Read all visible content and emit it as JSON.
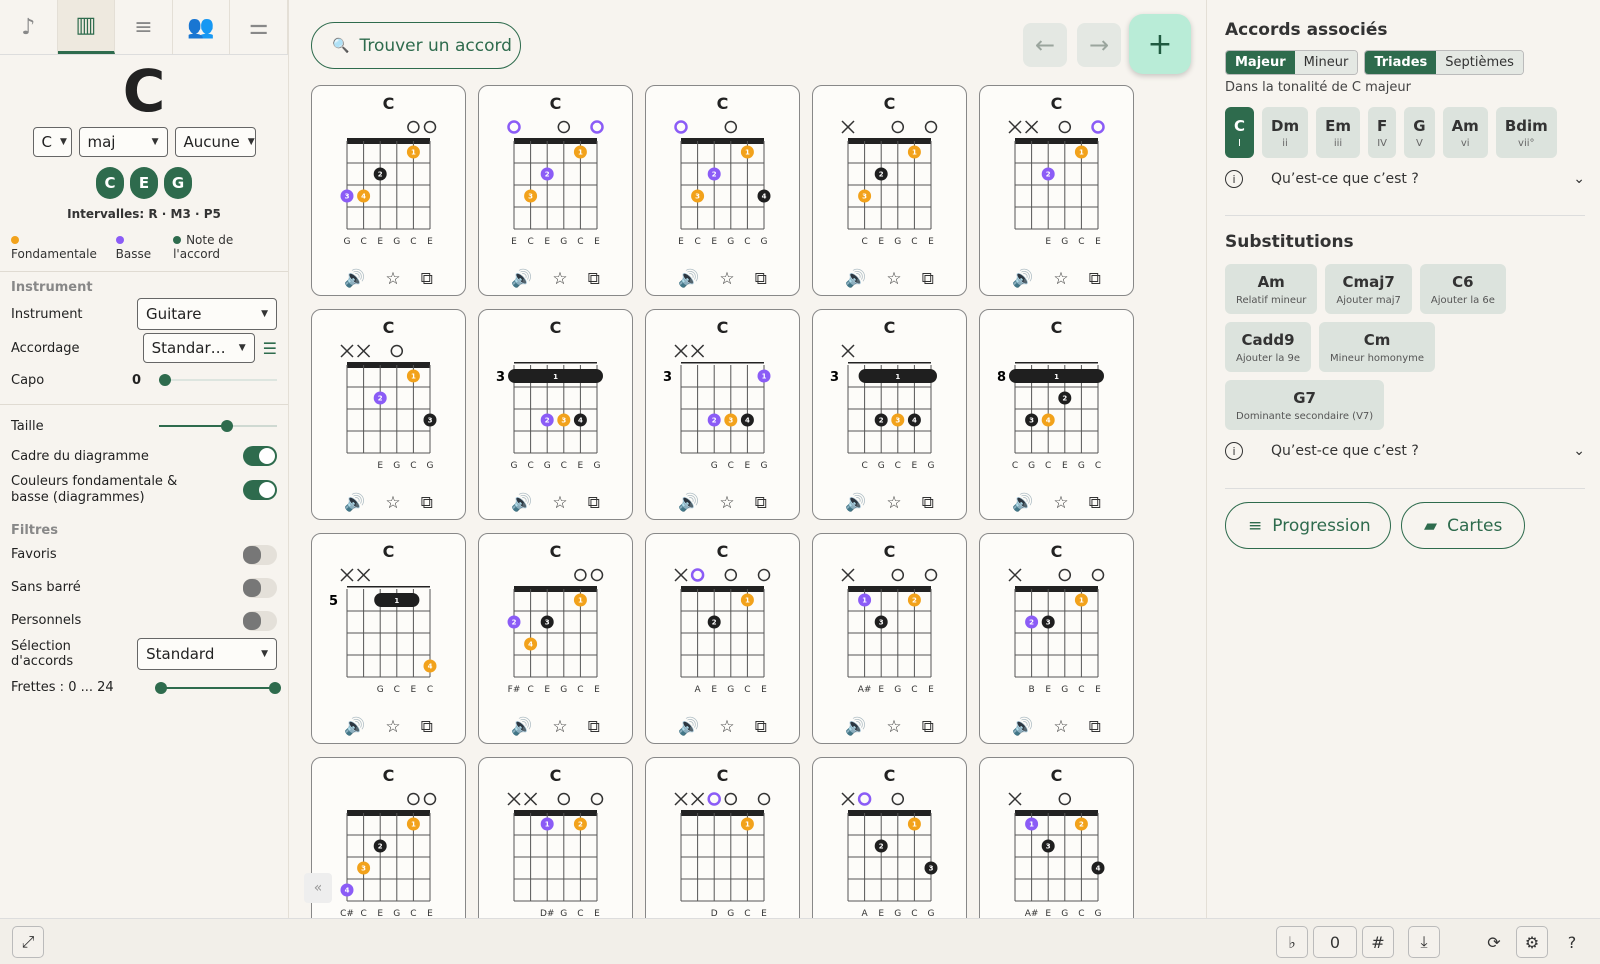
{
  "tabs": [
    {
      "icon": "♪",
      "name": "music-note-icon"
    },
    {
      "icon": "▥",
      "name": "piano-icon"
    },
    {
      "icon": "≡",
      "name": "playlist-icon"
    },
    {
      "icon": "👥",
      "name": "people-icon"
    },
    {
      "icon": "⚌",
      "name": "sliders-icon"
    }
  ],
  "chord": {
    "root": "C",
    "quality": "maj",
    "bass": "Aucune",
    "notes": [
      "C",
      "E",
      "G"
    ],
    "intervals": "Intervalles: R · M3 · P5"
  },
  "legend": {
    "root": "Fondamentale",
    "bass": "Basse",
    "note": "Note de l'accord"
  },
  "instrument_section": "Instrument",
  "instrument_label": "Instrument",
  "instrument_value": "Guitare",
  "tuning_label": "Accordage",
  "tuning_value": "Standar…",
  "capo_label": "Capo",
  "capo_value": "0",
  "size_label": "Taille",
  "frame_label": "Cadre du diagramme",
  "colors_label": "Couleurs fondamentale & basse (diagrammes)",
  "filters_section": "Filtres",
  "fav_label": "Favoris",
  "nobarre_label": "Sans barré",
  "personal_label": "Personnels",
  "selection_label": "Sélection d'accords",
  "selection_value": "Standard",
  "frets_label": "Frettes : 0 ... 24",
  "search_label": "Trouver un accord",
  "fab_label": "+",
  "card_name": "C",
  "colors": {
    "root": "#f2a21b",
    "bass": "#8b5cf6",
    "note": "#1f1f1f",
    "accent": "#2e6b4d"
  },
  "cards": [
    {
      "s": [
        "",
        "",
        "",
        "",
        "o",
        "o"
      ],
      "start": 1,
      "d": [
        {
          "st": 4,
          "f": 1,
          "n": "1",
          "r": true
        },
        {
          "st": 2,
          "f": 2,
          "n": "2"
        },
        {
          "st": 0,
          "f": 3,
          "n": "3",
          "b": true
        },
        {
          "st": 1,
          "f": 3,
          "n": "4",
          "r": true
        }
      ],
      "l": [
        "G",
        "C",
        "E",
        "G",
        "C",
        "E"
      ],
      "bs": 0,
      "rs": []
    },
    {
      "s": [
        "o",
        "",
        "",
        "o",
        "",
        "o"
      ],
      "start": 1,
      "d": [
        {
          "st": 4,
          "f": 1,
          "n": "1",
          "r": true
        },
        {
          "st": 2,
          "f": 2,
          "n": "2",
          "b": true
        },
        {
          "st": 1,
          "f": 3,
          "n": "3",
          "r": true
        }
      ],
      "l": [
        "E",
        "C",
        "E",
        "G",
        "C",
        "E"
      ],
      "bs": 0,
      "rs": [
        0,
        5
      ]
    },
    {
      "s": [
        "o",
        "",
        "",
        "o",
        "",
        ""
      ],
      "start": 1,
      "d": [
        {
          "st": 4,
          "f": 1,
          "n": "1",
          "r": true
        },
        {
          "st": 2,
          "f": 2,
          "n": "2",
          "b": true
        },
        {
          "st": 1,
          "f": 3,
          "n": "3",
          "r": true
        },
        {
          "st": 5,
          "f": 3,
          "n": "4"
        }
      ],
      "l": [
        "E",
        "C",
        "E",
        "G",
        "C",
        "G"
      ],
      "bs": 0,
      "rs": [
        0
      ]
    },
    {
      "s": [
        "x",
        "",
        "",
        "o",
        "",
        "o"
      ],
      "start": 1,
      "d": [
        {
          "st": 4,
          "f": 1,
          "n": "1",
          "r": true
        },
        {
          "st": 2,
          "f": 2,
          "n": "2"
        },
        {
          "st": 1,
          "f": 3,
          "n": "3",
          "r": true
        }
      ],
      "l": [
        "",
        "C",
        "E",
        "G",
        "C",
        "E"
      ],
      "bs": -1,
      "rs": []
    },
    {
      "s": [
        "x",
        "x",
        "",
        "o",
        "",
        "o"
      ],
      "start": 1,
      "d": [
        {
          "st": 4,
          "f": 1,
          "n": "1",
          "r": true
        },
        {
          "st": 2,
          "f": 2,
          "n": "2",
          "b": true
        }
      ],
      "l": [
        "",
        "",
        "E",
        "G",
        "C",
        "E"
      ],
      "bs": -1,
      "rs": [
        5
      ]
    },
    {
      "s": [
        "x",
        "x",
        "",
        "o",
        "",
        ""
      ],
      "start": 1,
      "d": [
        {
          "st": 4,
          "f": 1,
          "n": "1",
          "r": true
        },
        {
          "st": 2,
          "f": 2,
          "n": "2",
          "b": true
        },
        {
          "st": 5,
          "f": 3,
          "n": "3"
        }
      ],
      "l": [
        "",
        "",
        "E",
        "G",
        "C",
        "G"
      ],
      "bs": -1,
      "rs": []
    },
    {
      "s": [
        "",
        "",
        "",
        "",
        "",
        ""
      ],
      "start": 3,
      "barre": [
        0,
        5
      ],
      "d": [
        {
          "st": 2,
          "f": 3,
          "n": "2",
          "b": true
        },
        {
          "st": 3,
          "f": 3,
          "n": "3",
          "r": true
        },
        {
          "st": 4,
          "f": 3,
          "n": "4"
        }
      ],
      "l": [
        "G",
        "C",
        "G",
        "C",
        "E",
        "G"
      ],
      "bs": -1,
      "rs": []
    },
    {
      "s": [
        "x",
        "x",
        "",
        "",
        "",
        ""
      ],
      "start": 3,
      "d": [
        {
          "st": 5,
          "f": 1,
          "n": "1",
          "b": true
        },
        {
          "st": 2,
          "f": 3,
          "n": "2",
          "b": true
        },
        {
          "st": 3,
          "f": 3,
          "n": "3",
          "r": true
        },
        {
          "st": 4,
          "f": 3,
          "n": "4"
        }
      ],
      "l": [
        "",
        "",
        "G",
        "C",
        "E",
        "G"
      ],
      "bs": -1,
      "rs": []
    },
    {
      "s": [
        "x",
        "",
        "",
        "",
        "",
        ""
      ],
      "start": 3,
      "barre": [
        1,
        5
      ],
      "d": [
        {
          "st": 2,
          "f": 3,
          "n": "2"
        },
        {
          "st": 3,
          "f": 3,
          "n": "3",
          "r": true
        },
        {
          "st": 4,
          "f": 3,
          "n": "4"
        }
      ],
      "l": [
        "",
        "C",
        "G",
        "C",
        "E",
        "G"
      ],
      "bs": -1,
      "rs": []
    },
    {
      "s": [
        "",
        "",
        "",
        "",
        "",
        ""
      ],
      "start": 8,
      "barre": [
        0,
        5
      ],
      "d": [
        {
          "st": 3,
          "f": 2,
          "n": "2"
        },
        {
          "st": 1,
          "f": 3,
          "n": "3"
        },
        {
          "st": 2,
          "f": 3,
          "n": "4",
          "r": true
        }
      ],
      "l": [
        "C",
        "G",
        "C",
        "E",
        "G",
        "C"
      ],
      "bs": -1,
      "rs": []
    },
    {
      "s": [
        "x",
        "x",
        "",
        "",
        "",
        ""
      ],
      "start": 5,
      "barre": [
        2,
        4
      ],
      "d": [
        {
          "st": 5,
          "f": 4,
          "n": "4",
          "r": true
        }
      ],
      "l": [
        "",
        "",
        "G",
        "C",
        "E",
        "C"
      ],
      "bs": -1,
      "rs": []
    },
    {
      "s": [
        "",
        "",
        "",
        "",
        "o",
        "o"
      ],
      "start": 1,
      "d": [
        {
          "st": 4,
          "f": 1,
          "n": "1",
          "r": true
        },
        {
          "st": 0,
          "f": 2,
          "n": "2",
          "b": true
        },
        {
          "st": 2,
          "f": 2,
          "n": "3"
        },
        {
          "st": 1,
          "f": 3,
          "n": "4",
          "r": true
        }
      ],
      "l": [
        "F#",
        "C",
        "E",
        "G",
        "C",
        "E"
      ],
      "bs": -1,
      "rs": []
    },
    {
      "s": [
        "x",
        "o",
        "",
        "o",
        "",
        "o"
      ],
      "start": 1,
      "d": [
        {
          "st": 4,
          "f": 1,
          "n": "1",
          "r": true
        },
        {
          "st": 2,
          "f": 2,
          "n": "2"
        }
      ],
      "l": [
        "",
        "A",
        "E",
        "G",
        "C",
        "E"
      ],
      "bs": -1,
      "rs": [
        1
      ]
    },
    {
      "s": [
        "x",
        "",
        "",
        "o",
        "",
        "o"
      ],
      "start": 1,
      "d": [
        {
          "st": 1,
          "f": 1,
          "n": "1",
          "b": true
        },
        {
          "st": 4,
          "f": 1,
          "n": "2",
          "r": true
        },
        {
          "st": 2,
          "f": 2,
          "n": "3"
        }
      ],
      "l": [
        "",
        "A#",
        "E",
        "G",
        "C",
        "E"
      ],
      "bs": -1,
      "rs": []
    },
    {
      "s": [
        "x",
        "",
        "",
        "o",
        "",
        "o"
      ],
      "start": 1,
      "d": [
        {
          "st": 4,
          "f": 1,
          "n": "1",
          "r": true
        },
        {
          "st": 1,
          "f": 2,
          "n": "2",
          "b": true
        },
        {
          "st": 2,
          "f": 2,
          "n": "3"
        }
      ],
      "l": [
        "",
        "B",
        "E",
        "G",
        "C",
        "E"
      ],
      "bs": -1,
      "rs": []
    },
    {
      "s": [
        "",
        "",
        "",
        "",
        "o",
        "o"
      ],
      "start": 1,
      "d": [
        {
          "st": 4,
          "f": 1,
          "n": "1",
          "r": true
        },
        {
          "st": 2,
          "f": 2,
          "n": "2"
        },
        {
          "st": 1,
          "f": 3,
          "n": "3",
          "r": true
        },
        {
          "st": 0,
          "f": 4,
          "n": "4",
          "b": true
        }
      ],
      "l": [
        "C#",
        "C",
        "E",
        "G",
        "C",
        "E"
      ],
      "bs": -1,
      "rs": []
    },
    {
      "s": [
        "x",
        "x",
        "",
        "o",
        "",
        "o"
      ],
      "start": 1,
      "d": [
        {
          "st": 2,
          "f": 1,
          "n": "1",
          "b": true
        },
        {
          "st": 4,
          "f": 1,
          "n": "2",
          "r": true
        }
      ],
      "l": [
        "",
        "",
        "D#",
        "G",
        "C",
        "E"
      ],
      "bs": -1,
      "rs": []
    },
    {
      "s": [
        "x",
        "x",
        "o",
        "o",
        "",
        "o"
      ],
      "start": 1,
      "d": [
        {
          "st": 4,
          "f": 1,
          "n": "1",
          "r": true
        }
      ],
      "l": [
        "",
        "",
        "D",
        "G",
        "C",
        "E"
      ],
      "bs": -1,
      "rs": [
        2
      ]
    },
    {
      "s": [
        "x",
        "o",
        "",
        "o",
        "",
        ""
      ],
      "start": 1,
      "d": [
        {
          "st": 4,
          "f": 1,
          "n": "1",
          "r": true
        },
        {
          "st": 2,
          "f": 2,
          "n": "2"
        },
        {
          "st": 5,
          "f": 3,
          "n": "3"
        }
      ],
      "l": [
        "",
        "A",
        "E",
        "G",
        "C",
        "G"
      ],
      "bs": -1,
      "rs": [
        1
      ]
    },
    {
      "s": [
        "x",
        "",
        "",
        "o",
        "",
        ""
      ],
      "start": 1,
      "d": [
        {
          "st": 1,
          "f": 1,
          "n": "1",
          "b": true
        },
        {
          "st": 4,
          "f": 1,
          "n": "2",
          "r": true
        },
        {
          "st": 2,
          "f": 2,
          "n": "3"
        },
        {
          "st": 5,
          "f": 3,
          "n": "4"
        }
      ],
      "l": [
        "",
        "A#",
        "E",
        "G",
        "C",
        "G"
      ],
      "bs": -1,
      "rs": []
    }
  ],
  "right": {
    "related_title": "Accords associés",
    "mode_major": "Majeur",
    "mode_minor": "Mineur",
    "type_triads": "Triades",
    "type_sevenths": "Septièmes",
    "key_text": "Dans la tonalité de C majeur",
    "degrees": [
      {
        "c": "C",
        "r": "I"
      },
      {
        "c": "Dm",
        "r": "ii"
      },
      {
        "c": "Em",
        "r": "iii"
      },
      {
        "c": "F",
        "r": "IV"
      },
      {
        "c": "G",
        "r": "V"
      },
      {
        "c": "Am",
        "r": "vi"
      },
      {
        "c": "Bdim",
        "r": "vii°"
      }
    ],
    "what": "Qu’est-ce que c’est ?",
    "subs_title": "Substitutions",
    "subs": [
      {
        "c": "Am",
        "d": "Relatif mineur"
      },
      {
        "c": "Cmaj7",
        "d": "Ajouter maj7"
      },
      {
        "c": "C6",
        "d": "Ajouter la 6e"
      },
      {
        "c": "Cadd9",
        "d": "Ajouter la 9e"
      },
      {
        "c": "Cm",
        "d": "Mineur homonyme"
      },
      {
        "c": "G7",
        "d": "Dominante secondaire (V7)"
      }
    ],
    "what2": "Qu’est-ce que c’est ?",
    "progression": "Progression",
    "cards_btn": "Cartes"
  },
  "bottom": {
    "flat": "♭",
    "transpose": "0",
    "sharp": "#"
  }
}
